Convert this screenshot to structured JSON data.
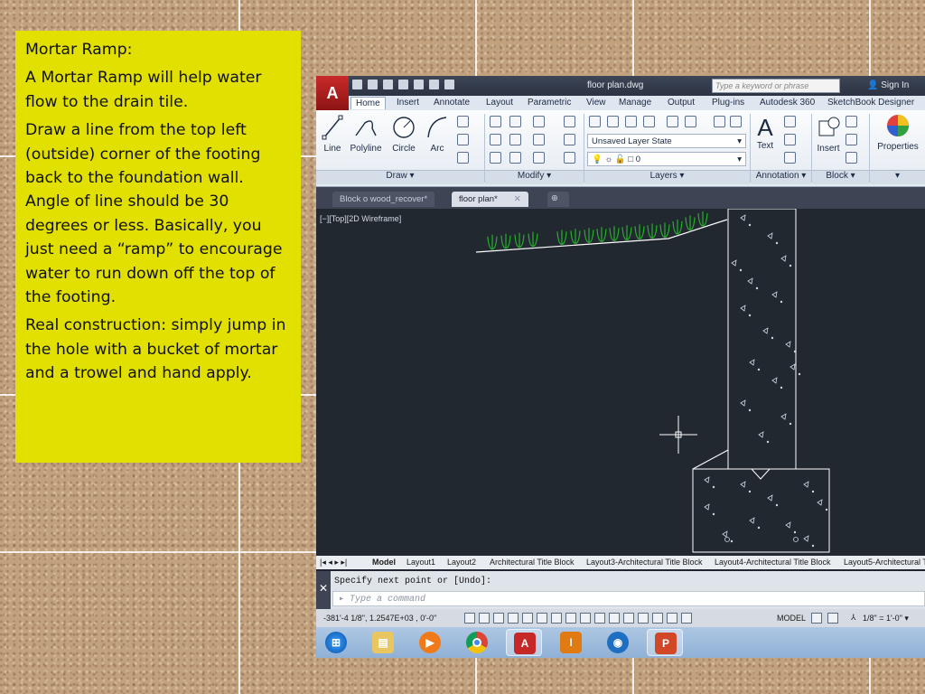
{
  "note": {
    "title": "Mortar Ramp:",
    "p1": "A Mortar Ramp will help water flow to the drain tile.",
    "p2": "Draw a line from the top left (outside) corner of the footing back to the foundation wall. Angle of line should be 30 degrees or less.  Basically, you just need a “ramp” to encourage water to run down off the top of the footing.",
    "p3": "Real construction: simply jump in the hole with a bucket of mortar and a trowel and hand apply."
  },
  "app": {
    "logo": "A",
    "file_title": "floor plan.dwg",
    "search_placeholder": "Type a keyword or phrase",
    "sign_in": "Sign In",
    "ribbon_tabs": [
      "Home",
      "Insert",
      "Annotate",
      "Layout",
      "Parametric",
      "View",
      "Manage",
      "Output",
      "Plug-ins",
      "Autodesk 360",
      "SketchBook Designer"
    ],
    "draw_tools": [
      "Line",
      "Polyline",
      "Circle",
      "Arc"
    ],
    "layer_state": "Unsaved Layer State",
    "layer_value": "0",
    "annotation_text": "Text",
    "block_insert": "Insert",
    "properties": "Properties",
    "panels": [
      "Draw ▾",
      "Modify ▾",
      "Layers ▾",
      "Annotation ▾",
      "Block ▾",
      "▾"
    ],
    "doc_tabs": [
      "Block o wood_recover*",
      "floor plan*"
    ],
    "viewport_label": "[−][Top][2D Wireframe]",
    "layout_tabs": [
      "Model",
      "Layout1",
      "Layout2",
      "Architectural Title Block",
      "Layout3-Architectural Title Block",
      "Layout4-Architectural Title Block",
      "Layout5-Architectural T"
    ],
    "cmd_output": "Specify next point or [Undo]:",
    "cmd_placeholder": "Type a command",
    "coords": "-381'-4 1/8\", 1.2547E+03 , 0'-0\"",
    "model": "MODEL",
    "scale": "1/8\" = 1'-0\" ▾"
  },
  "colors": {
    "note_bg": "#e2e000",
    "canvas_bg": "#212830",
    "grass": "#27b02a",
    "ramp": "#ffffff"
  },
  "taskbar_icons": [
    "windows-start-icon",
    "file-explorer-icon",
    "media-player-icon",
    "chrome-icon",
    "autocad-icon",
    "inventor-icon",
    "viewer-icon",
    "powerpoint-icon"
  ]
}
